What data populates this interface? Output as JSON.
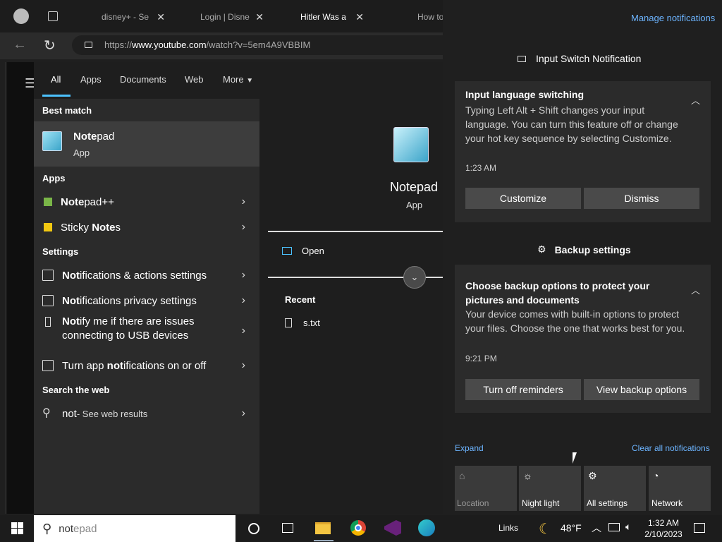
{
  "browser": {
    "tabs": [
      {
        "label": "disney+ - Se"
      },
      {
        "label": "Login | Disne"
      },
      {
        "label": "Hitler Was a"
      },
      {
        "label": "How to"
      }
    ],
    "url_prefix": "https://",
    "url_host": "www.youtube.com",
    "url_path": "/watch?v=5em4A9VBBIM"
  },
  "start": {
    "tabs": [
      "All",
      "Apps",
      "Documents",
      "Web",
      "More"
    ],
    "best_match_header": "Best match",
    "best_match": {
      "name_bold": "Note",
      "name_rest": "pad",
      "type": "App"
    },
    "apps_header": "Apps",
    "apps": [
      {
        "bold": "Note",
        "rest": "pad++"
      },
      {
        "pre": "Sticky ",
        "bold": "Note",
        "rest": "s"
      }
    ],
    "settings_header": "Settings",
    "settings": [
      {
        "bold": "Not",
        "rest": "ifications & actions settings"
      },
      {
        "bold": "Not",
        "rest": "ifications privacy settings"
      },
      {
        "bold": "Not",
        "rest": "ify me if there are issues",
        "line2": "connecting to USB devices"
      },
      {
        "pre": "Turn app ",
        "bold": "not",
        "rest": "ifications on or off"
      }
    ],
    "web_header": "Search the web",
    "web": {
      "query": "not",
      "hint": " - See web results"
    },
    "preview": {
      "name": "Notepad",
      "type": "App",
      "open": "Open",
      "recent_header": "Recent",
      "recent": [
        "s.txt"
      ]
    }
  },
  "notifications": {
    "manage": "Manage notifications",
    "groups": [
      {
        "app": "Input Switch Notification",
        "title": "Input language switching",
        "body": "Typing Left Alt + Shift changes your input language. You can turn this feature off or change your hot key sequence by selecting Customize.",
        "time": "1:23 AM",
        "buttons": [
          "Customize",
          "Dismiss"
        ]
      },
      {
        "app": "Backup settings",
        "title": "Choose backup options to protect your pictures and documents",
        "body": "Your device comes with built-in options to protect your files. Choose the one that works best for you.",
        "time": "9:21 PM",
        "buttons": [
          "Turn off reminders",
          "View backup options"
        ]
      }
    ],
    "expand": "Expand",
    "clear_all": "Clear all notifications",
    "quick_actions": [
      {
        "label": "Location",
        "icon": "location-icon",
        "dim": true
      },
      {
        "label": "Night light",
        "icon": "night-light-icon",
        "dim": false
      },
      {
        "label": "All settings",
        "icon": "gear-icon",
        "dim": false
      },
      {
        "label": "Network",
        "icon": "network-icon",
        "dim": false
      }
    ]
  },
  "taskbar": {
    "search_query": "not",
    "search_suggest": "epad",
    "links": "Links",
    "weather": "48°F",
    "time": "1:32 AM",
    "date": "2/10/2023"
  }
}
